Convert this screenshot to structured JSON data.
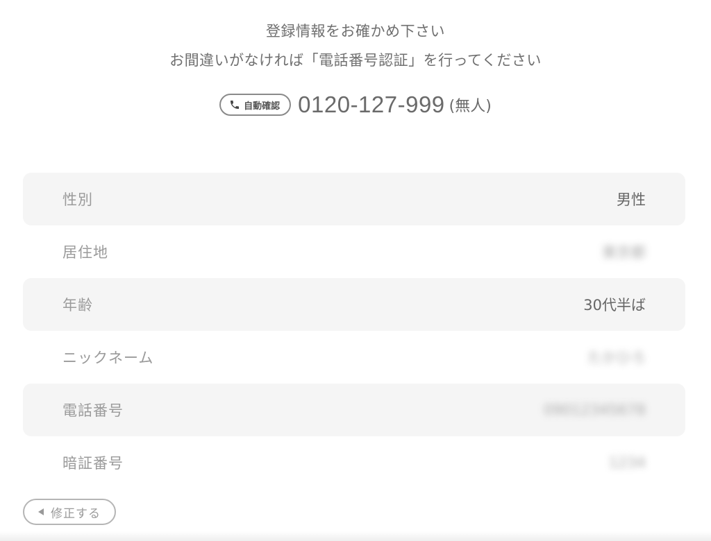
{
  "header": {
    "line1": "登録情報をお確かめ下さい",
    "line2": "お間違いがなければ「電話番号認証」を行ってください"
  },
  "phone": {
    "badge_label": "自動確認",
    "badge_icon": "phone-icon",
    "number": "0120-127-999",
    "note": "(無人)"
  },
  "profile": {
    "rows": [
      {
        "label": "性別",
        "value": "男性",
        "blurred": false
      },
      {
        "label": "居住地",
        "value": "東京都",
        "blurred": true
      },
      {
        "label": "年齢",
        "value": "30代半ば",
        "blurred": false
      },
      {
        "label": "ニックネーム",
        "value": "たかひろ",
        "blurred": true
      },
      {
        "label": "電話番号",
        "value": "09012345678",
        "blurred": true
      },
      {
        "label": "暗証番号",
        "value": "1234",
        "blurred": true
      }
    ]
  },
  "actions": {
    "back_label": "修正する",
    "back_icon": "triangle-left-icon"
  },
  "colors": {
    "text": "#777777",
    "row_shade": "#f5f5f5",
    "badge_border": "#8a8a8a"
  }
}
